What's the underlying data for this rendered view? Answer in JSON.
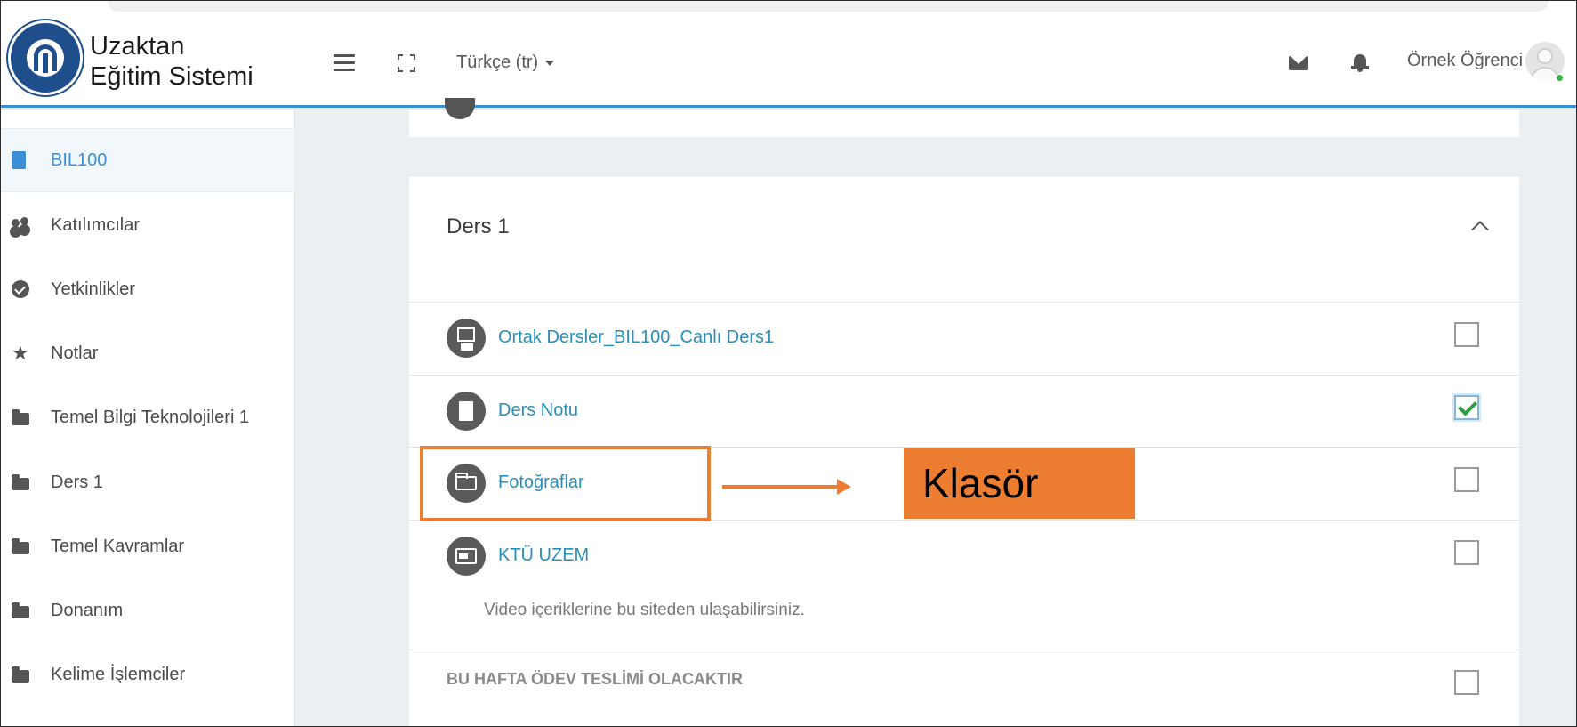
{
  "header": {
    "brand_line1": "Uzaktan",
    "brand_line2": "Eğitim Sistemi",
    "language": "Türkçe (tr)",
    "username": "Örnek Öğrenci",
    "accent_color": "#3b8fd6"
  },
  "sidebar": {
    "items": [
      {
        "label": "BIL100",
        "icon": "book-icon",
        "active": true
      },
      {
        "label": "Katılımcılar",
        "icon": "users-icon"
      },
      {
        "label": "Yetkinlikler",
        "icon": "check-circle-icon"
      },
      {
        "label": "Notlar",
        "icon": "star-icon"
      },
      {
        "label": "Temel Bilgi Teknolojileri 1",
        "icon": "folder-icon"
      },
      {
        "label": "Ders 1",
        "icon": "folder-icon"
      },
      {
        "label": "Temel Kavramlar",
        "icon": "folder-icon"
      },
      {
        "label": "Donanım",
        "icon": "folder-icon"
      },
      {
        "label": "Kelime İşlemciler",
        "icon": "folder-icon"
      }
    ]
  },
  "section": {
    "title": "Ders 1",
    "activities": [
      {
        "label": "Ortak Dersler_BIL100_Canlı Ders1",
        "icon": "presentation-icon",
        "completed": false
      },
      {
        "label": "Ders Notu",
        "icon": "document-icon",
        "completed": true
      },
      {
        "label": "Fotoğraflar",
        "icon": "folder-icon",
        "completed": false
      },
      {
        "label": "KTÜ UZEM",
        "icon": "url-icon",
        "completed": false,
        "description": "Video içeriklerine bu siteden ulaşabilirsiniz."
      },
      {
        "label": "BU HAFTA ÖDEV TESLİMİ OLACAKTIR",
        "completed": false
      }
    ]
  },
  "annotation": {
    "callout_text": "Klasör",
    "color": "#ed7d31"
  }
}
